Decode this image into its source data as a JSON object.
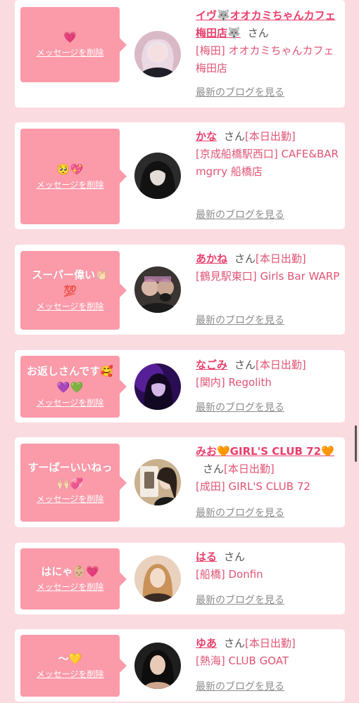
{
  "delete_label": "メッセージを削除",
  "blog_label": "最新のブログを見る",
  "san": "さん",
  "cards": [
    {
      "message": "💗",
      "name": "イヴ🐺オオカミちゃんカフェ梅田店🐺",
      "shift": "",
      "shop": "[梅田] オオカミちゃんカフェ梅田店"
    },
    {
      "message": "🥺💖",
      "name": "かな",
      "shift": "[本日出勤]",
      "shop": "[京成船橋駅西口] CAFE&BAR mgrry 船橋店"
    },
    {
      "message": "スーパー偉い👏🏻\n💯",
      "name": "あかね",
      "shift": "[本日出勤]",
      "shop": "[鶴見駅東口] Girls Bar WARP"
    },
    {
      "message": "お返しさんです🥰\n💜💚",
      "name": "なごみ",
      "shift": "[本日出勤]",
      "shop": "[関内] Regolith"
    },
    {
      "message": "すーぱーいいねっ\n🙌🏻💞",
      "name": "みお🧡GIRL'S CLUB 72🧡",
      "shift": "[本日出勤]",
      "shop": "[成田] GIRL'S CLUB 72"
    },
    {
      "message": "はにゃ👶🏼💗",
      "name": "はる",
      "shift": "",
      "shop": "[船橋] Donfin"
    },
    {
      "message": "〜💛",
      "name": "ゆあ",
      "shift": "[本日出勤]",
      "shop": "[熱海] CLUB GOAT"
    }
  ],
  "colors": {
    "background": "#fadbe0",
    "bubble": "#fb9aa9",
    "name": "#e83f6c",
    "shop": "#e05475",
    "blog_link": "#8c8c8c"
  }
}
